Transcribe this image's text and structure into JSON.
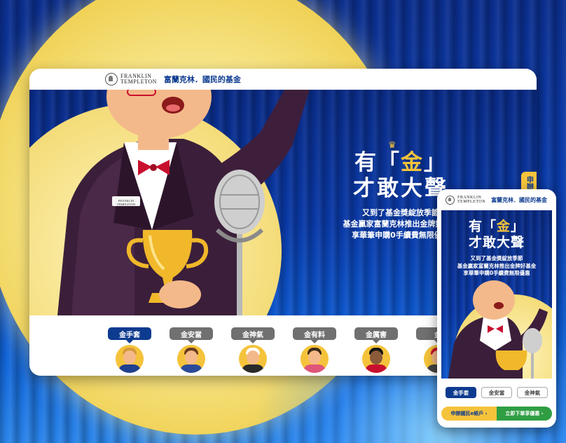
{
  "brand": {
    "logo_line1": "FRANKLIN",
    "logo_line2": "TEMPLETON",
    "tagline": "富蘭克林．國民的基金"
  },
  "hero": {
    "title_line1_left": "有「",
    "title_line1_gold": "金",
    "title_line1_right": "」",
    "title_line2": "才敢大聲",
    "sub_line1": "又到了基金獎綻放季節",
    "sub_line2": "基金贏家富蘭克林推出金牌好基金",
    "sub_line3": "享華筆申購0手續費無限優惠",
    "side_tab": "申辦國民e"
  },
  "tabs": [
    {
      "label": "金手套",
      "active": true
    },
    {
      "label": "金安當",
      "active": false
    },
    {
      "label": "金神氣",
      "active": false
    },
    {
      "label": "金有料",
      "active": false
    },
    {
      "label": "金厲害",
      "active": false
    },
    {
      "label": "金",
      "active": false
    }
  ],
  "name_badge": {
    "line1": "FRANKLIN",
    "line2": "TEMPLETON"
  },
  "mobile": {
    "tabs": [
      {
        "label": "金手套",
        "active": true
      },
      {
        "label": "金安當",
        "active": false
      },
      {
        "label": "金神氣",
        "active": false
      }
    ],
    "cta_left": "申辦國民e帳戶 ›",
    "cta_right": "立即下單享優惠 ›"
  },
  "colors": {
    "brand_blue": "#0d3b8f",
    "gold": "#f5c33b",
    "curtain_blue": "#0a3aa8",
    "cta_green": "#2f9e43"
  }
}
